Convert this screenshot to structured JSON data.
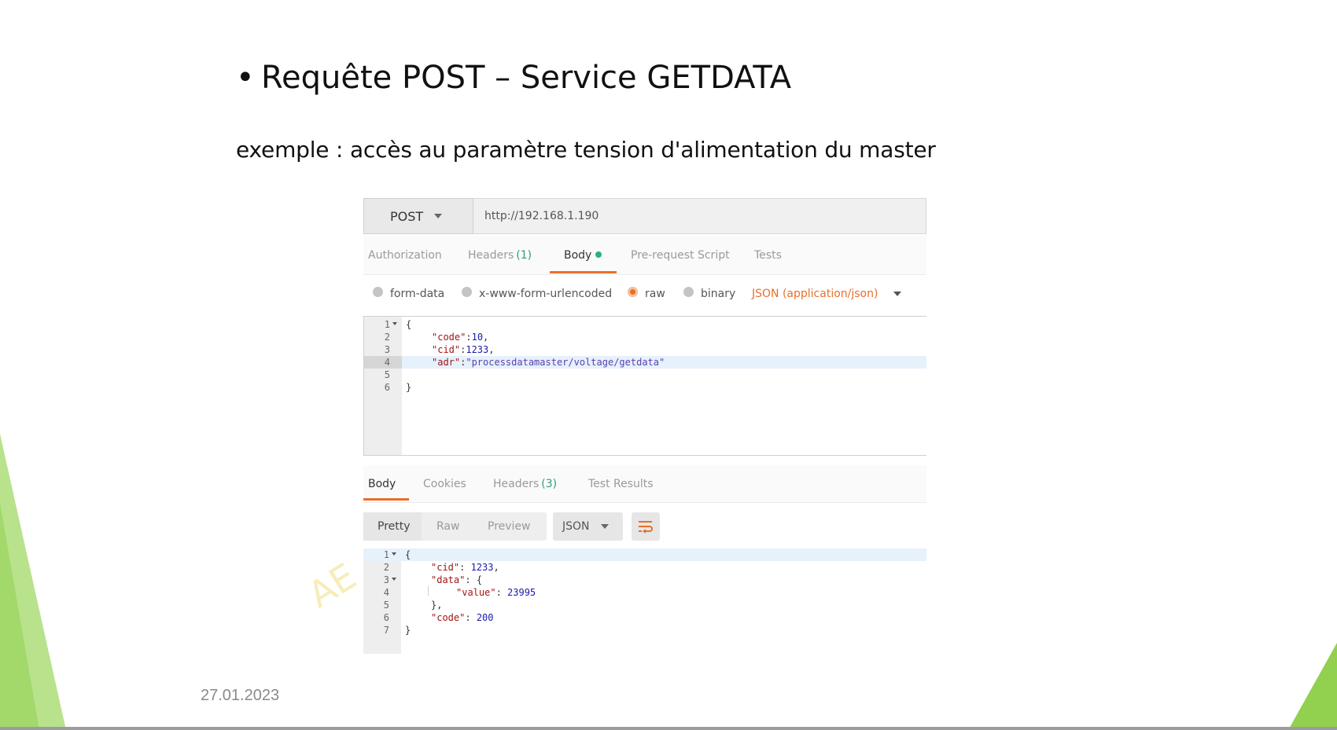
{
  "slide": {
    "title": "Requête POST – Service GETDATA",
    "bullet": "•",
    "subtitle": "exemple : accès au paramètre tension d'alimentation du master",
    "date": "27.01.2023",
    "watermark": "AE",
    "accent_color": "#92d050"
  },
  "request": {
    "method": "POST",
    "url": "http://192.168.1.190",
    "tabs": [
      {
        "label": "Authorization"
      },
      {
        "label": "Headers",
        "count": "(1)"
      },
      {
        "label": "Body",
        "active": true
      },
      {
        "label": "Pre-request Script"
      },
      {
        "label": "Tests"
      }
    ],
    "body_types": [
      {
        "label": "form-data",
        "checked": false
      },
      {
        "label": "x-www-form-urlencoded",
        "checked": false
      },
      {
        "label": "raw",
        "checked": true
      },
      {
        "label": "binary",
        "checked": false
      }
    ],
    "content_type": "JSON (application/json)",
    "code_lines": [
      {
        "num": "1",
        "text": "{"
      },
      {
        "num": "2",
        "key": "\"code\"",
        "sep": ":",
        "value": "10",
        "tail": ","
      },
      {
        "num": "3",
        "key": "\"cid\"",
        "sep": ":",
        "value": "1233",
        "tail": ","
      },
      {
        "num": "4",
        "key": "\"adr\"",
        "sep": ":",
        "string": "\"processdatamaster/voltage/getdata\""
      },
      {
        "num": "5",
        "text": ""
      },
      {
        "num": "6",
        "text": "}"
      }
    ]
  },
  "response": {
    "tabs": [
      {
        "label": "Body",
        "active": true
      },
      {
        "label": "Cookies"
      },
      {
        "label": "Headers",
        "count": "(3)"
      },
      {
        "label": "Test Results"
      }
    ],
    "views": [
      "Pretty",
      "Raw",
      "Preview"
    ],
    "language": "JSON",
    "code_lines": [
      {
        "num": "1",
        "text": "{"
      },
      {
        "num": "2",
        "key": "\"cid\"",
        "sep": ": ",
        "value": "1233",
        "tail": ","
      },
      {
        "num": "3",
        "key": "\"data\"",
        "sep": ": ",
        "tail": "{"
      },
      {
        "num": "4",
        "key": "\"value\"",
        "sep": ": ",
        "value": "23995"
      },
      {
        "num": "5",
        "text": "},"
      },
      {
        "num": "6",
        "key": "\"code\"",
        "sep": ": ",
        "value": "200"
      },
      {
        "num": "7",
        "text": "}"
      }
    ]
  }
}
